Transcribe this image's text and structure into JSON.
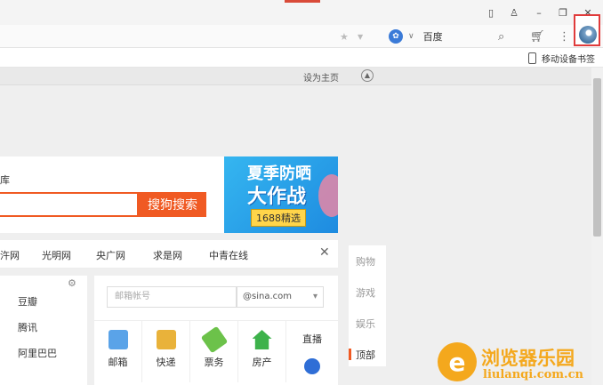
{
  "toolbar": {
    "search_engine": "百度"
  },
  "bookmarks": {
    "mobile_bookmarks": "移动设备书签"
  },
  "page_header": {
    "set_home": "设为主页"
  },
  "search": {
    "partial_label": "库",
    "button": "搜狗搜索"
  },
  "banner": {
    "line1": "夏季防晒",
    "line2": "大作战",
    "tag": "1688精选"
  },
  "news_links": [
    "汻网",
    "光明网",
    "央广网",
    "求是网",
    "中青在线"
  ],
  "left_links": [
    "豆瓣",
    "腾讯",
    "阿里巴巴"
  ],
  "mail": {
    "account_placeholder": "邮箱帐号",
    "domain": "@sina.com"
  },
  "services": [
    "邮箱",
    "快递",
    "票务",
    "房产"
  ],
  "live_label": "直播",
  "categories": [
    "购物",
    "游戏",
    "娱乐",
    "顶部"
  ],
  "watermark": {
    "title": "浏览器乐园",
    "url": "liulanqi.com.cn"
  },
  "colors": {
    "accent": "#f05a23",
    "highlight_box": "#e03b3b",
    "watermark": "#f4a81d"
  }
}
